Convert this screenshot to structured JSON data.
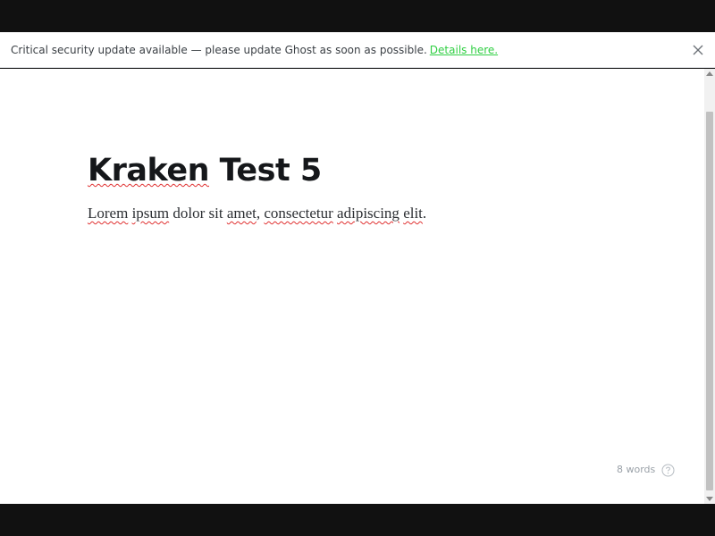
{
  "banner": {
    "message": "Critical security update available — please update Ghost as soon as possible.",
    "link_label": "Details here.",
    "close_icon": "close-icon",
    "link_color": "#30cf43"
  },
  "post": {
    "title_word_1": "Kraken",
    "title_rest": " Test 5",
    "body_words": [
      "Lorem",
      " ",
      "ipsum",
      " dolor sit ",
      "amet",
      ", ",
      "consectetur",
      " ",
      "adipiscing",
      " ",
      "elit",
      "."
    ]
  },
  "footer": {
    "word_count": "8 words",
    "help_icon": "question-circle-icon"
  }
}
